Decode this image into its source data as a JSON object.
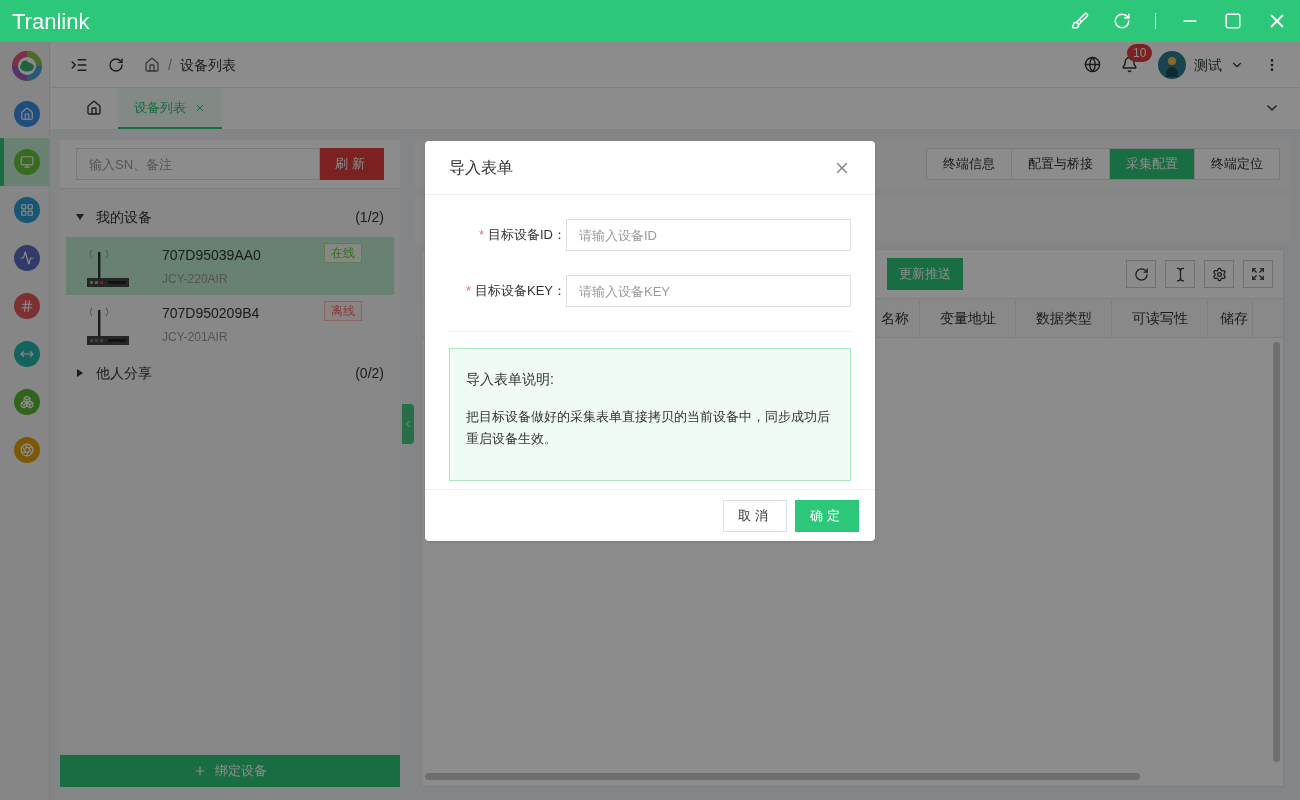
{
  "window": {
    "title": "Tranlink"
  },
  "nav_rail": {
    "items": [
      {
        "kind": "logo",
        "selected": false
      },
      {
        "kind": "home",
        "selected": false
      },
      {
        "kind": "monitor",
        "selected": true
      },
      {
        "kind": "grid",
        "selected": false
      },
      {
        "kind": "chart",
        "selected": false
      },
      {
        "kind": "hash",
        "selected": false
      },
      {
        "kind": "width",
        "selected": false
      },
      {
        "kind": "boxes",
        "selected": false
      },
      {
        "kind": "ball",
        "selected": false
      }
    ]
  },
  "header": {
    "breadcrumb_separator": "/",
    "breadcrumb": [
      "设备列表"
    ],
    "notification_count": "10",
    "user": "测试"
  },
  "tabs": [
    {
      "kind": "home",
      "selected": false
    },
    {
      "kind": "page",
      "label": "设备列表",
      "selected": true
    }
  ],
  "device_panel": {
    "search": {
      "placeholder": "输入SN、备注"
    },
    "refresh_button": "刷新",
    "groups": [
      {
        "name": "我的设备",
        "count": "(1/2)",
        "expanded": true,
        "devices": [
          {
            "sn": "707D95039AA0",
            "model": "JCY-220AIR",
            "status": "在线",
            "online": true,
            "selected": true
          },
          {
            "sn": "707D950209B4",
            "model": "JCY-201AIR",
            "status": "离线",
            "online": false,
            "selected": false
          }
        ]
      },
      {
        "name": "他人分享",
        "count": "(0/2)",
        "expanded": false
      }
    ],
    "bind_button": "绑定设备"
  },
  "detail": {
    "sections": [
      {
        "label": "终端信息",
        "selected": false
      },
      {
        "label": "配置与桥接",
        "selected": false
      },
      {
        "label": "采集配置",
        "selected": true
      },
      {
        "label": "终端定位",
        "selected": false
      }
    ],
    "table": {
      "action_button": "更新推送",
      "columns": [
        "名称",
        "变量地址",
        "数据类型",
        "可读写性",
        "储存"
      ]
    }
  },
  "dialog": {
    "title": "导入表单",
    "fields": [
      {
        "marker": "*",
        "label": "目标设备ID：",
        "placeholder": "请输入设备ID"
      },
      {
        "marker": "*",
        "label": "目标设备KEY：",
        "placeholder": "请输入设备KEY"
      }
    ],
    "note": {
      "title": "导入表单说明:",
      "text": "把目标设备做好的采集表单直接拷贝的当前设备中，同步成功后重启设备生效。"
    },
    "buttons": [
      {
        "label": "取消",
        "kind": "secondary"
      },
      {
        "label": "确定",
        "kind": "primary"
      }
    ]
  }
}
